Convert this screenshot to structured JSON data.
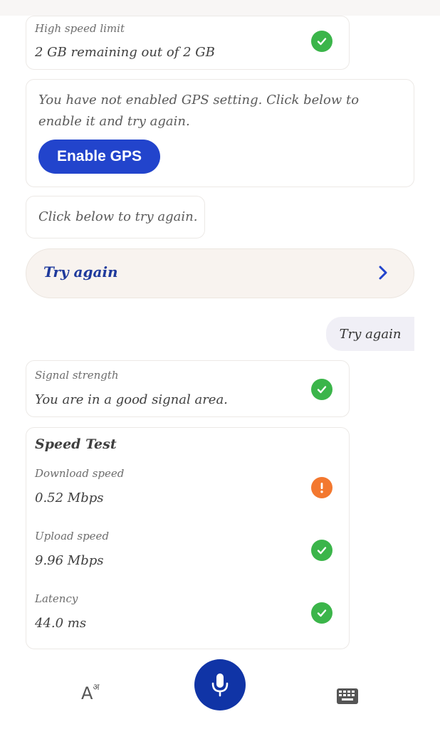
{
  "top_card": {
    "label": "High speed limit",
    "value": "2 GB remaining out of 2 GB"
  },
  "gps_card": {
    "message": "You have not enabled GPS setting. Click below to enable it and try again.",
    "button": "Enable GPS"
  },
  "retry_card": {
    "message": "Click below to try again."
  },
  "retry_bar": {
    "label": "Try again"
  },
  "user_message": "Try again",
  "signal_card": {
    "label": "Signal strength",
    "value": "You are in a good signal area."
  },
  "speed_card": {
    "title": "Speed Test",
    "items": [
      {
        "label": "Download speed",
        "value": "0.52 Mbps",
        "status": "warning"
      },
      {
        "label": "Upload speed",
        "value": "9.96 Mbps",
        "status": "ok"
      },
      {
        "label": "Latency",
        "value": "44.0 ms",
        "status": "ok"
      }
    ]
  },
  "bottom_bar": {
    "font_icon_glyph": "A",
    "font_icon_sup": "अ"
  },
  "colors": {
    "success": "#3bb54a",
    "warning": "#f3782f",
    "primary": "#2244cc",
    "mic": "#1034a6"
  }
}
